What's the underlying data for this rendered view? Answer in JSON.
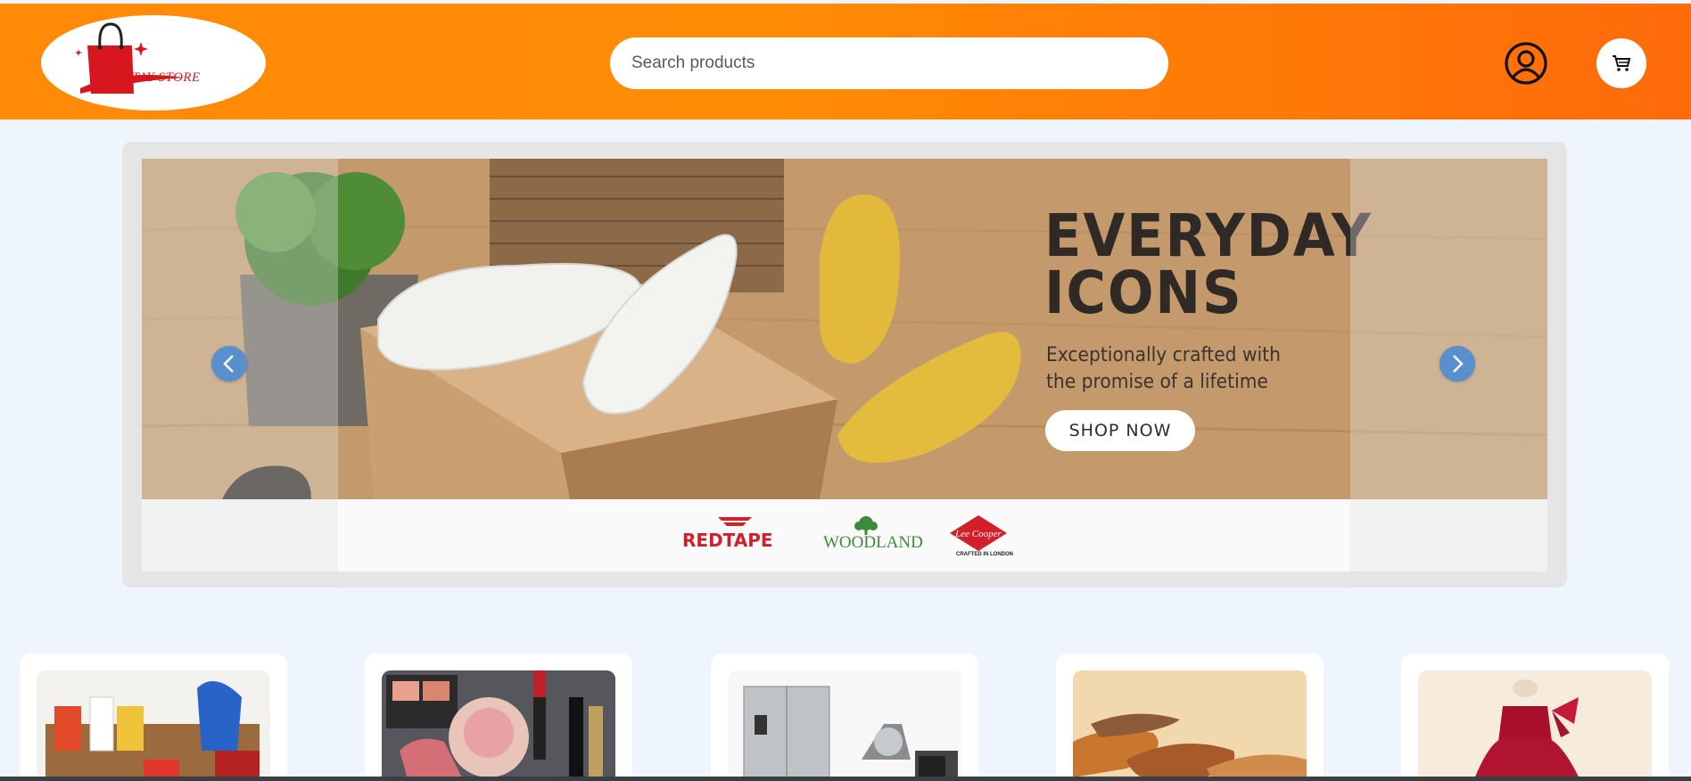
{
  "header": {
    "logo_text": "MYSTAY STORE",
    "search_placeholder": "Search products",
    "account_icon": "user-circle-icon",
    "cart_icon": "shopping-cart-icon",
    "colors": {
      "gradient_start": "#ff8a08",
      "gradient_end": "#ff6a0a"
    }
  },
  "carousel": {
    "headline": "EVERYDAY\nICONS",
    "tagline": "Exceptionally crafted with\nthe promise of a lifetime",
    "cta_label": "SHOP NOW",
    "brands": [
      {
        "name": "REDTAPE"
      },
      {
        "name": "WOODLAND"
      },
      {
        "name": "Lee Cooper",
        "tagline": "CRAFTED IN LONDON"
      }
    ],
    "prev_icon": "chevron-left-icon",
    "next_icon": "chevron-right-icon",
    "arrow_color": "#5a8fcd"
  },
  "categories": [
    {
      "image": "groceries"
    },
    {
      "image": "cosmetics"
    },
    {
      "image": "home-appliances"
    },
    {
      "image": "footwear"
    },
    {
      "image": "kids-dress"
    }
  ]
}
